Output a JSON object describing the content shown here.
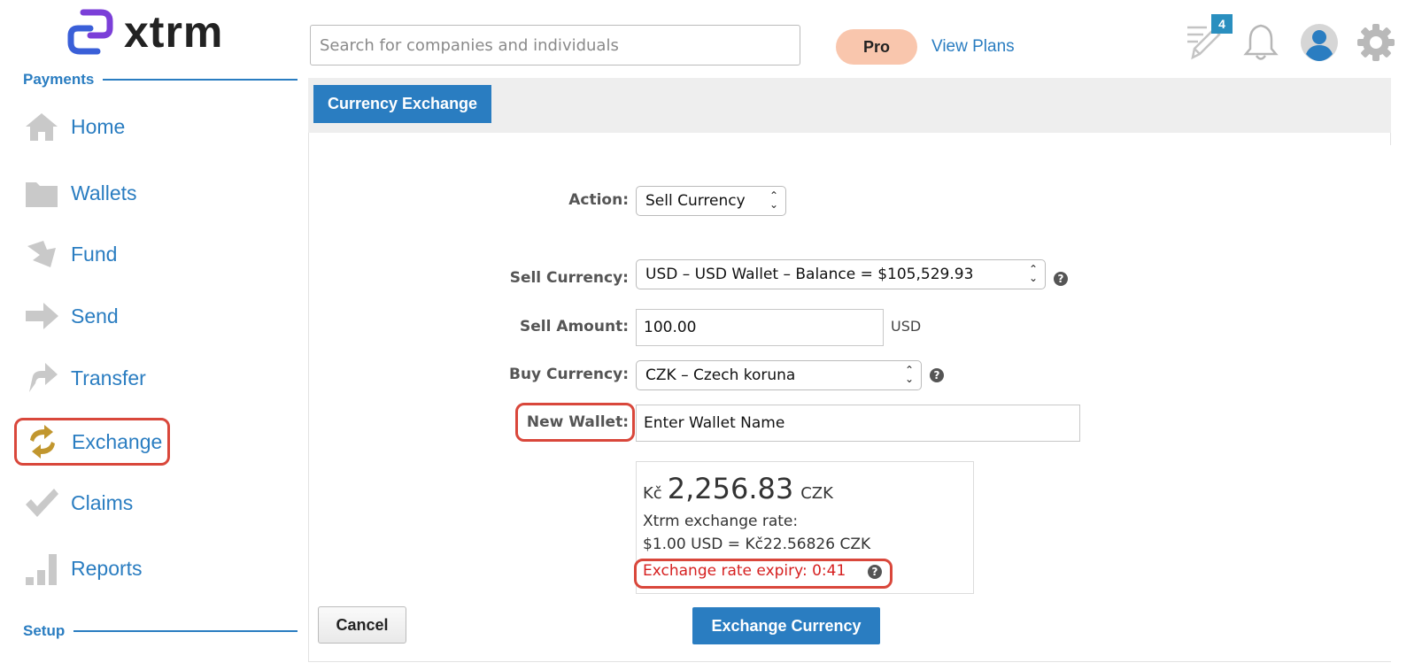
{
  "brand": {
    "name": "xtrm",
    "accent": "#2a7dc1",
    "logo_color": "#7b3fd8",
    "alert_color": "#d9473b"
  },
  "sidebar": {
    "sections": [
      {
        "label": "Payments"
      },
      {
        "label": "Setup"
      }
    ],
    "items": [
      {
        "label": "Home",
        "icon": "home-icon"
      },
      {
        "label": "Wallets",
        "icon": "folder-icon"
      },
      {
        "label": "Fund",
        "icon": "fund-arrow-icon"
      },
      {
        "label": "Send",
        "icon": "send-arrow-icon"
      },
      {
        "label": "Transfer",
        "icon": "transfer-arrow-icon"
      },
      {
        "label": "Exchange",
        "icon": "exchange-icon",
        "active": true
      },
      {
        "label": "Claims",
        "icon": "checkmark-icon"
      },
      {
        "label": "Reports",
        "icon": "bar-chart-icon"
      }
    ]
  },
  "header": {
    "search_placeholder": "Search for companies and individuals",
    "plan_badge": "Pro",
    "view_plans": "View Plans",
    "tasks_count": "4",
    "icons": [
      "edit-tasks-icon",
      "bell-icon",
      "user-avatar-icon",
      "gear-icon"
    ]
  },
  "panel": {
    "tab": "Currency Exchange",
    "form": {
      "action_label": "Action:",
      "action_value": "Sell Currency",
      "sell_currency_label": "Sell Currency:",
      "sell_currency_value": "USD – USD Wallet – Balance = $105,529.93",
      "sell_amount_label": "Sell Amount:",
      "sell_amount_value": "100.00",
      "sell_amount_unit": "USD",
      "buy_currency_label": "Buy Currency:",
      "buy_currency_value": "CZK – Czech koruna",
      "new_wallet_label": "New Wallet:",
      "new_wallet_value": "Enter Wallet Name"
    },
    "quote": {
      "symbol": "Kč",
      "amount": "2,256.83",
      "currency": "CZK",
      "rate_label": "Xtrm exchange rate:",
      "rate_value": "$1.00 USD = Kč22.56826 CZK",
      "expiry": "Exchange rate expiry: 0:41"
    },
    "buttons": {
      "cancel": "Cancel",
      "submit": "Exchange Currency"
    }
  }
}
